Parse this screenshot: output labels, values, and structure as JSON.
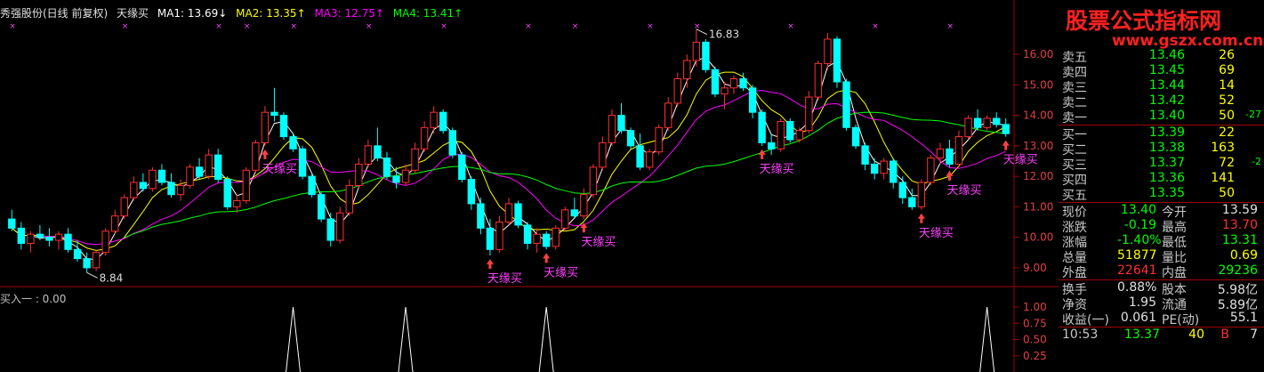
{
  "header": {
    "stock": "秀强股份(日线 前复权)",
    "indicator": "天缘买",
    "ma1": "MA1: 13.69↓",
    "ma2": "MA2: 13.35↑",
    "ma3": "MA3: 12.75↑",
    "ma4": "MA4: 13.41↑"
  },
  "sub_header": "买入一 : 0.00",
  "brand": {
    "line1": "股票公式指标网",
    "line2": "www.gszx.com.cn"
  },
  "colors": {
    "up": "#ff3030",
    "down": "#00ffff",
    "ma1": "#ffffff",
    "ma2": "#ffff00",
    "ma3": "#ff00ff",
    "ma4": "#00ff00",
    "grid": "#a00000"
  },
  "axis_labels": {
    "main": [
      "16.00",
      "15.00",
      "14.00",
      "13.00",
      "12.00",
      "11.00",
      "10.00",
      "9.00"
    ],
    "sub": [
      "1.00",
      "0.75",
      "0.50",
      "0.25"
    ]
  },
  "annotations": {
    "high": "16.83",
    "low": "8.84",
    "signal": "天缘买"
  },
  "order_book": {
    "asks": [
      {
        "label": "卖五",
        "price": "13.46",
        "vol": "26"
      },
      {
        "label": "卖四",
        "price": "13.45",
        "vol": "69"
      },
      {
        "label": "卖三",
        "price": "13.44",
        "vol": "14"
      },
      {
        "label": "卖二",
        "price": "13.42",
        "vol": "52"
      },
      {
        "label": "卖一",
        "price": "13.40",
        "vol": "50",
        "chg": "-27"
      }
    ],
    "bids": [
      {
        "label": "买一",
        "price": "13.39",
        "vol": "22"
      },
      {
        "label": "买二",
        "price": "13.38",
        "vol": "163"
      },
      {
        "label": "买三",
        "price": "13.37",
        "vol": "72",
        "chg": "-2"
      },
      {
        "label": "买四",
        "price": "13.36",
        "vol": "141"
      },
      {
        "label": "买五",
        "price": "13.35",
        "vol": "50"
      }
    ]
  },
  "quote": [
    {
      "l1": "现价",
      "v1": "13.40",
      "c1": "green",
      "l2": "今开",
      "v2": "13.59",
      "c2": "white"
    },
    {
      "l1": "涨跌",
      "v1": "-0.19",
      "c1": "green",
      "l2": "最高",
      "v2": "13.70",
      "c2": "red"
    },
    {
      "l1": "涨幅",
      "v1": "-1.40%",
      "c1": "green",
      "l2": "最低",
      "v2": "13.31",
      "c2": "green"
    },
    {
      "l1": "总量",
      "v1": "51877",
      "c1": "yellow",
      "l2": "量比",
      "v2": "0.69",
      "c2": "yellow"
    },
    {
      "l1": "外盘",
      "v1": "22641",
      "c1": "red",
      "l2": "内盘",
      "v2": "29236",
      "c2": "green"
    },
    {
      "l1": "换手",
      "v1": "0.88%",
      "c1": "white",
      "l2": "股本",
      "v2": "5.98亿",
      "c2": "white"
    },
    {
      "l1": "净资",
      "v1": "1.95",
      "c1": "white",
      "l2": "流通",
      "v2": "5.89亿",
      "c2": "white"
    },
    {
      "l1": "收益(一)",
      "v1": "0.061",
      "c1": "white",
      "l2": "PE(动)",
      "v2": "55.1",
      "c2": "white"
    }
  ],
  "tick": {
    "time": "10:53",
    "price": "13.37",
    "vol": "40",
    "side": "B",
    "n": "7"
  },
  "chart_data": {
    "type": "candlestick",
    "ylim": [
      8.5,
      17.2
    ],
    "candles": [
      [
        10.6,
        10.9,
        10.2,
        10.3
      ],
      [
        10.3,
        10.5,
        9.6,
        9.8
      ],
      [
        9.8,
        10.2,
        9.5,
        10.1
      ],
      [
        10.1,
        10.4,
        9.9,
        10.0
      ],
      [
        10.0,
        10.3,
        9.7,
        9.9
      ],
      [
        9.9,
        10.2,
        9.6,
        10.1
      ],
      [
        10.1,
        10.3,
        9.5,
        9.6
      ],
      [
        9.6,
        9.9,
        9.2,
        9.3
      ],
      [
        9.3,
        9.5,
        8.84,
        9.0
      ],
      [
        9.0,
        9.6,
        8.9,
        9.5
      ],
      [
        9.5,
        10.3,
        9.4,
        10.2
      ],
      [
        10.2,
        10.9,
        10.1,
        10.7
      ],
      [
        10.7,
        11.4,
        10.6,
        11.3
      ],
      [
        11.3,
        12.0,
        11.2,
        11.8
      ],
      [
        11.8,
        12.1,
        11.5,
        11.6
      ],
      [
        11.6,
        12.3,
        11.5,
        12.2
      ],
      [
        12.2,
        12.4,
        11.7,
        11.8
      ],
      [
        11.8,
        12.1,
        11.3,
        11.4
      ],
      [
        11.4,
        11.9,
        11.2,
        11.7
      ],
      [
        11.7,
        12.4,
        11.6,
        12.3
      ],
      [
        12.3,
        12.6,
        11.9,
        12.0
      ],
      [
        12.0,
        12.9,
        11.9,
        12.7
      ],
      [
        12.7,
        12.9,
        11.8,
        11.9
      ],
      [
        11.9,
        12.0,
        10.9,
        11.0
      ],
      [
        11.0,
        11.4,
        10.8,
        11.2
      ],
      [
        11.2,
        12.3,
        11.1,
        12.2
      ],
      [
        12.2,
        13.2,
        12.1,
        13.1
      ],
      [
        13.1,
        14.3,
        13.0,
        14.1
      ],
      [
        14.1,
        14.9,
        13.8,
        14.0
      ],
      [
        14.0,
        14.1,
        13.2,
        13.3
      ],
      [
        13.3,
        13.4,
        12.8,
        12.9
      ],
      [
        12.9,
        13.0,
        11.9,
        12.0
      ],
      [
        12.0,
        12.1,
        11.3,
        11.4
      ],
      [
        11.4,
        11.5,
        10.5,
        10.6
      ],
      [
        10.6,
        10.8,
        9.7,
        9.9
      ],
      [
        9.9,
        11.0,
        9.8,
        10.8
      ],
      [
        10.8,
        11.9,
        10.7,
        11.7
      ],
      [
        11.7,
        12.6,
        11.6,
        12.4
      ],
      [
        12.4,
        13.2,
        12.3,
        13.0
      ],
      [
        13.0,
        13.6,
        12.5,
        12.6
      ],
      [
        12.6,
        12.8,
        11.9,
        12.0
      ],
      [
        12.0,
        12.3,
        11.6,
        11.8
      ],
      [
        11.8,
        12.4,
        11.7,
        12.2
      ],
      [
        12.2,
        13.1,
        12.1,
        12.9
      ],
      [
        12.9,
        13.8,
        12.8,
        13.6
      ],
      [
        13.6,
        14.3,
        13.4,
        14.1
      ],
      [
        14.1,
        14.2,
        13.4,
        13.5
      ],
      [
        13.5,
        13.6,
        12.6,
        12.7
      ],
      [
        12.7,
        12.8,
        11.8,
        11.9
      ],
      [
        11.9,
        12.0,
        10.9,
        11.1
      ],
      [
        11.1,
        11.3,
        10.1,
        10.3
      ],
      [
        10.3,
        10.6,
        9.4,
        9.6
      ],
      [
        9.6,
        10.7,
        9.5,
        10.5
      ],
      [
        10.5,
        11.3,
        10.4,
        11.1
      ],
      [
        11.1,
        11.2,
        10.3,
        10.4
      ],
      [
        10.4,
        10.5,
        9.6,
        9.8
      ],
      [
        9.8,
        10.3,
        9.5,
        10.1
      ],
      [
        10.1,
        10.2,
        9.6,
        9.7
      ],
      [
        9.7,
        10.4,
        9.6,
        10.3
      ],
      [
        10.3,
        11.0,
        10.2,
        10.9
      ],
      [
        10.9,
        11.3,
        10.6,
        10.7
      ],
      [
        10.7,
        11.6,
        10.6,
        11.4
      ],
      [
        11.4,
        12.4,
        11.3,
        12.3
      ],
      [
        12.3,
        13.3,
        12.2,
        13.1
      ],
      [
        13.1,
        14.2,
        13.0,
        14.0
      ],
      [
        14.0,
        14.4,
        13.4,
        13.5
      ],
      [
        13.5,
        13.6,
        12.9,
        13.0
      ],
      [
        13.0,
        13.4,
        12.2,
        12.3
      ],
      [
        12.3,
        12.9,
        12.2,
        12.8
      ],
      [
        12.8,
        13.7,
        12.7,
        13.6
      ],
      [
        13.6,
        14.6,
        13.5,
        14.4
      ],
      [
        14.4,
        15.4,
        14.3,
        15.2
      ],
      [
        15.2,
        16.0,
        14.9,
        15.8
      ],
      [
        15.8,
        16.83,
        15.6,
        16.4
      ],
      [
        16.4,
        16.5,
        15.4,
        15.5
      ],
      [
        15.5,
        15.6,
        14.6,
        14.7
      ],
      [
        14.7,
        15.1,
        14.2,
        14.9
      ],
      [
        14.9,
        15.3,
        14.7,
        15.2
      ],
      [
        15.2,
        15.4,
        14.8,
        14.9
      ],
      [
        14.9,
        15.0,
        13.9,
        14.1
      ],
      [
        14.1,
        14.2,
        13.0,
        13.1
      ],
      [
        13.1,
        13.4,
        12.7,
        12.9
      ],
      [
        12.9,
        13.9,
        12.8,
        13.8
      ],
      [
        13.8,
        13.9,
        13.1,
        13.2
      ],
      [
        13.2,
        13.6,
        13.1,
        13.5
      ],
      [
        13.5,
        14.8,
        13.4,
        14.6
      ],
      [
        14.6,
        15.8,
        14.5,
        15.7
      ],
      [
        15.7,
        16.7,
        15.5,
        16.5
      ],
      [
        16.5,
        16.6,
        14.9,
        15.1
      ],
      [
        15.1,
        15.2,
        13.5,
        13.6
      ],
      [
        13.6,
        13.7,
        12.9,
        13.0
      ],
      [
        13.0,
        13.1,
        12.2,
        12.4
      ],
      [
        12.4,
        12.6,
        11.9,
        12.1
      ],
      [
        12.1,
        12.6,
        11.9,
        12.5
      ],
      [
        12.5,
        12.6,
        11.6,
        11.8
      ],
      [
        11.8,
        12.0,
        11.1,
        11.3
      ],
      [
        11.3,
        11.6,
        10.9,
        11.0
      ],
      [
        11.0,
        11.9,
        10.9,
        11.8
      ],
      [
        11.8,
        12.7,
        11.7,
        12.6
      ],
      [
        12.6,
        13.1,
        12.4,
        12.9
      ],
      [
        12.9,
        13.2,
        12.3,
        12.4
      ],
      [
        12.4,
        13.5,
        12.3,
        13.3
      ],
      [
        13.3,
        14.0,
        13.2,
        13.9
      ],
      [
        13.9,
        14.2,
        13.5,
        13.6
      ],
      [
        13.6,
        14.0,
        13.5,
        13.9
      ],
      [
        13.9,
        14.1,
        13.6,
        13.7
      ],
      [
        13.7,
        13.9,
        13.3,
        13.4
      ]
    ],
    "signals": [
      27,
      51,
      57,
      61,
      80,
      97,
      100,
      106
    ],
    "sub_peaks": [
      30,
      42,
      57,
      104
    ]
  },
  "top_markers": [
    0,
    12,
    22,
    25,
    30,
    38,
    46,
    55,
    60,
    68,
    73,
    83,
    92,
    100
  ]
}
